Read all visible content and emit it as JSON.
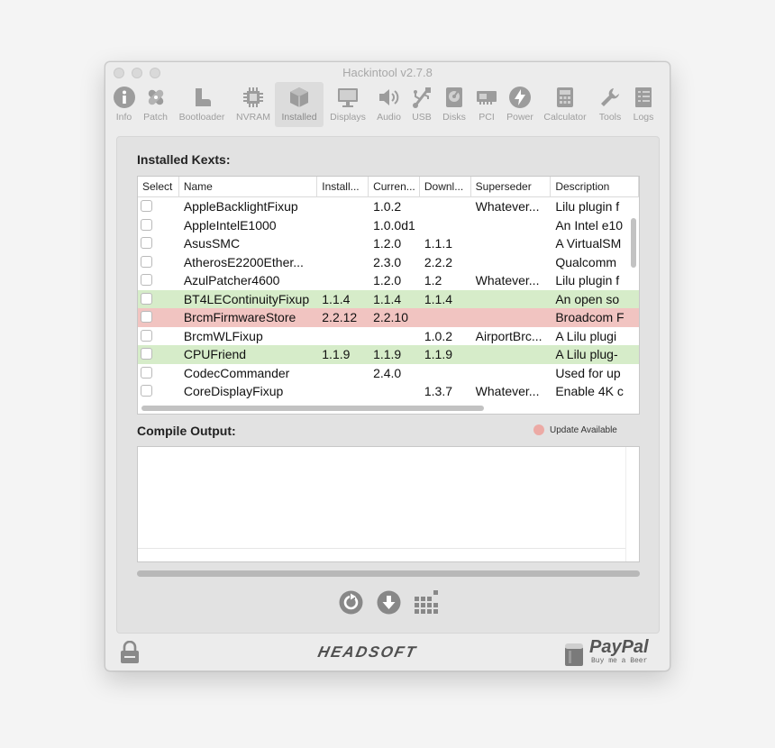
{
  "window": {
    "title": "Hackintool v2.7.8"
  },
  "toolbar": [
    {
      "label": "Info",
      "icon": "info-icon",
      "active": false
    },
    {
      "label": "Patch",
      "icon": "bandage-icon",
      "active": false
    },
    {
      "label": "Bootloader",
      "icon": "boot-icon",
      "active": false
    },
    {
      "label": "NVRAM",
      "icon": "chip-icon",
      "active": false
    },
    {
      "label": "Installed",
      "icon": "cube-icon",
      "active": true
    },
    {
      "label": "Displays",
      "icon": "monitor-icon",
      "active": false
    },
    {
      "label": "Audio",
      "icon": "speaker-icon",
      "active": false
    },
    {
      "label": "USB",
      "icon": "usb-icon",
      "active": false
    },
    {
      "label": "Disks",
      "icon": "disk-icon",
      "active": false
    },
    {
      "label": "PCI",
      "icon": "pci-card-icon",
      "active": false
    },
    {
      "label": "Power",
      "icon": "power-bolt-icon",
      "active": false
    },
    {
      "label": "Calculator",
      "icon": "calculator-icon",
      "active": false
    },
    {
      "label": "Tools",
      "icon": "wrench-icon",
      "active": false
    },
    {
      "label": "Logs",
      "icon": "logs-icon",
      "active": false
    }
  ],
  "installed": {
    "heading": "Installed Kexts:",
    "columns": [
      "Select",
      "Name",
      "Install...",
      "Curren...",
      "Downl...",
      "Superseder",
      "Description"
    ],
    "rows": [
      {
        "name": "AppleBacklightFixup",
        "installed": "",
        "current": "1.0.2",
        "download": "",
        "superseder": "Whatever...",
        "description": "Lilu plugin f",
        "status": "none"
      },
      {
        "name": "AppleIntelE1000",
        "installed": "",
        "current": "1.0.0d1",
        "download": "",
        "superseder": "",
        "description": "An Intel e10",
        "status": "none"
      },
      {
        "name": "AsusSMC",
        "installed": "",
        "current": "1.2.0",
        "download": "1.1.1",
        "superseder": "",
        "description": "A VirtualSM",
        "status": "none"
      },
      {
        "name": "AtherosE2200Ether...",
        "installed": "",
        "current": "2.3.0",
        "download": "2.2.2",
        "superseder": "",
        "description": "Qualcomm",
        "status": "none"
      },
      {
        "name": "AzulPatcher4600",
        "installed": "",
        "current": "1.2.0",
        "download": "1.2",
        "superseder": "Whatever...",
        "description": "Lilu plugin f",
        "status": "none"
      },
      {
        "name": "BT4LEContinuityFixup",
        "installed": "1.1.4",
        "current": "1.1.4",
        "download": "1.1.4",
        "superseder": "",
        "description": "An open so",
        "status": "installed"
      },
      {
        "name": "BrcmFirmwareStore",
        "installed": "2.2.12",
        "current": "2.2.10",
        "download": "",
        "superseder": "",
        "description": "Broadcom F",
        "status": "update"
      },
      {
        "name": "BrcmWLFixup",
        "installed": "",
        "current": "",
        "download": "1.0.2",
        "superseder": "AirportBrc...",
        "description": "A Lilu plugi",
        "status": "none"
      },
      {
        "name": "CPUFriend",
        "installed": "1.1.9",
        "current": "1.1.9",
        "download": "1.1.9",
        "superseder": "",
        "description": "A Lilu plug-",
        "status": "installed"
      },
      {
        "name": "CodecCommander",
        "installed": "",
        "current": "2.4.0",
        "download": "",
        "superseder": "",
        "description": "Used for up",
        "status": "none"
      },
      {
        "name": "CoreDisplayFixup",
        "installed": "",
        "current": "",
        "download": "1.3.7",
        "superseder": "Whatever...",
        "description": "Enable 4K c",
        "status": "none"
      }
    ]
  },
  "compile": {
    "heading": "Compile Output:",
    "text": ""
  },
  "legend": {
    "label": "Update Available",
    "color": "#ecaaa5"
  },
  "footer": {
    "brand": "HEADSOFT",
    "paypal_name": "PayPal",
    "paypal_sub": "Buy me a Beer"
  },
  "colors": {
    "installed_row": "#d6ecc9",
    "update_row": "#f1c4c1",
    "selected_tab_bg": "#dcdcdc"
  }
}
